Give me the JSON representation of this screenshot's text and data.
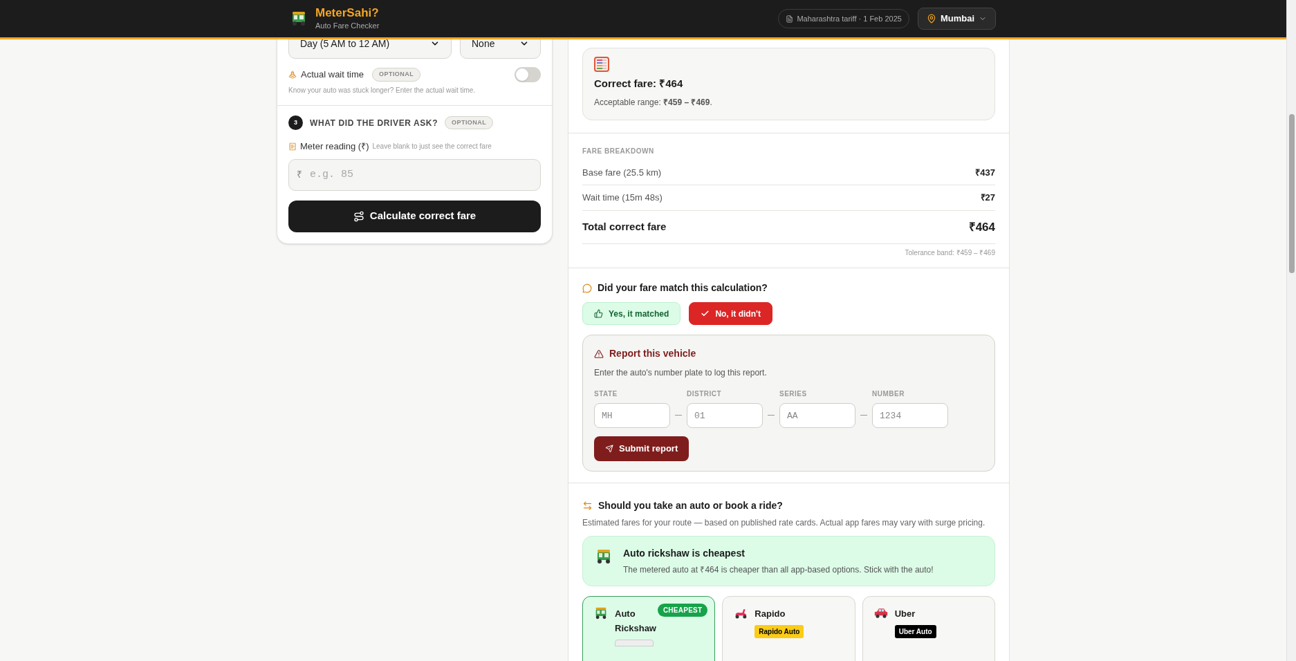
{
  "header": {
    "brand": "MeterSahi?",
    "subtitle": "Auto Fare Checker",
    "tariff": "Maharashtra tariff · 1 Feb 2025",
    "city": "Mumbai"
  },
  "trip_form": {
    "time_select": "Day (5 AM to 12 AM)",
    "extra_select": "None",
    "wait_time": {
      "label": "Actual wait time",
      "badge": "OPTIONAL",
      "on": false,
      "hint": "Know your auto was stuck longer? Enter the actual wait time."
    },
    "step": {
      "number": "3",
      "title": "WHAT DID THE DRIVER ASK?",
      "badge": "OPTIONAL"
    },
    "meter": {
      "label": "Meter reading (₹)",
      "hint": "Leave blank to just see the correct fare",
      "prefix": "₹",
      "placeholder": "e.g. 85"
    },
    "calculate_button": "Calculate correct fare"
  },
  "result": {
    "title": "Correct fare: ₹464",
    "range": "Acceptable range: **₹459 – ₹469**."
  },
  "breakdown": {
    "heading": "FARE BREAKDOWN",
    "rows": [
      {
        "label": "Base fare (25.5 km)",
        "amount": "₹437"
      },
      {
        "label": "Wait time (15m 48s)",
        "amount": "₹27"
      }
    ],
    "total": {
      "label": "Total correct fare",
      "amount": "₹464"
    },
    "tolerance": "Tolerance band: ₹459 – ₹469"
  },
  "feedback": {
    "question": "Did your fare match this calculation?",
    "options": [
      {
        "label": "Yes, it matched",
        "selected": false
      },
      {
        "label": "No, it didn't",
        "selected": true
      }
    ]
  },
  "report": {
    "title": "Report this vehicle",
    "description": "Enter the auto's number plate to log this report.",
    "fields": [
      {
        "label": "STATE",
        "placeholder": "MH"
      },
      {
        "label": "DISTRICT",
        "placeholder": "01"
      },
      {
        "label": "SERIES",
        "placeholder": "AA"
      },
      {
        "label": "NUMBER",
        "placeholder": "1234"
      }
    ],
    "submit_button": "Submit report"
  },
  "comparison": {
    "title": "Should you take an auto or book a ride?",
    "description": "Estimated fares for your route — based on published rate cards. Actual app fares may vary with surge pricing.",
    "banner": {
      "title": "Auto rickshaw is cheapest",
      "text": "The metered auto at ₹464 is cheaper than all app-based options. Stick with the auto!"
    },
    "options": [
      {
        "kind": "auto",
        "name": "Auto Rickshaw",
        "badge": "CHEAPEST",
        "cheapest": true
      },
      {
        "kind": "scooter",
        "name": "Rapido",
        "cheapest": false,
        "tag": {
          "label": "Rapido Auto",
          "color": "#facc15"
        }
      },
      {
        "kind": "car",
        "name": "Uber",
        "cheapest": false,
        "tag": {
          "label": "Uber Auto",
          "color": "#000000"
        }
      }
    ]
  }
}
